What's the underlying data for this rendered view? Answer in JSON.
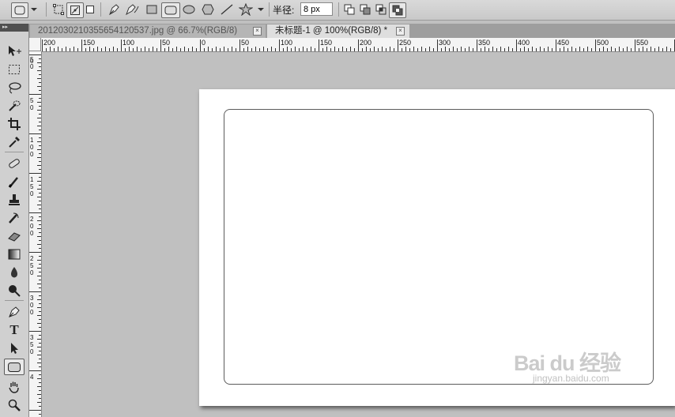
{
  "options_bar": {
    "radius_label": "半径:",
    "radius_value": "8 px",
    "active_shape_tool": "rounded-rectangle",
    "path_mode": "paths"
  },
  "tabs": [
    {
      "title": "20120302103556541205​37.jpg @ 66.7%(RGB/8)",
      "active": false,
      "close": "×"
    },
    {
      "title": "未标题-1 @ 100%(RGB/8) *",
      "active": true,
      "close": "×"
    }
  ],
  "ruler_top": {
    "labels": [
      "200",
      "150",
      "100",
      "50",
      "0",
      "50",
      "100",
      "150",
      "200",
      "250",
      "300",
      "350",
      "400",
      "450",
      "500",
      "550"
    ]
  },
  "ruler_left": {
    "labels": [
      "5\n0",
      "0",
      "5\n0",
      "1\n0\n0",
      "1\n5\n0",
      "2\n0\n0",
      "2\n5\n0",
      "3\n0\n0",
      "3\n5\n0",
      "4"
    ]
  },
  "toolbox": {
    "header": "▸▸",
    "tools": [
      {
        "name": "move-tool",
        "icon": "move-icon"
      },
      {
        "name": "marquee-tool",
        "icon": "marquee-icon"
      },
      {
        "name": "lasso-tool",
        "icon": "lasso-icon"
      },
      {
        "name": "quick-selection-tool",
        "icon": "quick-select-icon"
      },
      {
        "name": "crop-tool",
        "icon": "crop-icon"
      },
      {
        "name": "eyedropper-tool",
        "icon": "eyedropper-icon"
      },
      {
        "name": "healing-brush-tool",
        "icon": "bandage-icon"
      },
      {
        "name": "brush-tool",
        "icon": "brush-icon"
      },
      {
        "name": "clone-stamp-tool",
        "icon": "stamp-icon"
      },
      {
        "name": "history-brush-tool",
        "icon": "history-brush-icon"
      },
      {
        "name": "eraser-tool",
        "icon": "eraser-icon"
      },
      {
        "name": "gradient-tool",
        "icon": "gradient-icon"
      },
      {
        "name": "blur-tool",
        "icon": "drop-icon"
      },
      {
        "name": "dodge-tool",
        "icon": "dodge-icon"
      },
      {
        "name": "pen-tool",
        "icon": "pen-icon"
      },
      {
        "name": "type-tool",
        "icon": "type-icon",
        "glyph": "T"
      },
      {
        "name": "path-selection-tool",
        "icon": "arrow-icon"
      },
      {
        "name": "rounded-rectangle-tool",
        "icon": "rounded-rect-icon",
        "active": true
      },
      {
        "name": "hand-tool",
        "icon": "hand-icon"
      },
      {
        "name": "zoom-tool",
        "icon": "magnifier-icon"
      }
    ]
  },
  "document": {
    "background": "#ffffff",
    "shape": "rounded-rectangle-path"
  },
  "watermark": {
    "brand": "Bai du 经验",
    "url": "jingyan.baidu.com"
  },
  "colors": {
    "workspace": "#c0c0c0",
    "canvas": "#ffffff",
    "path_stroke": "#5c5c5c"
  }
}
